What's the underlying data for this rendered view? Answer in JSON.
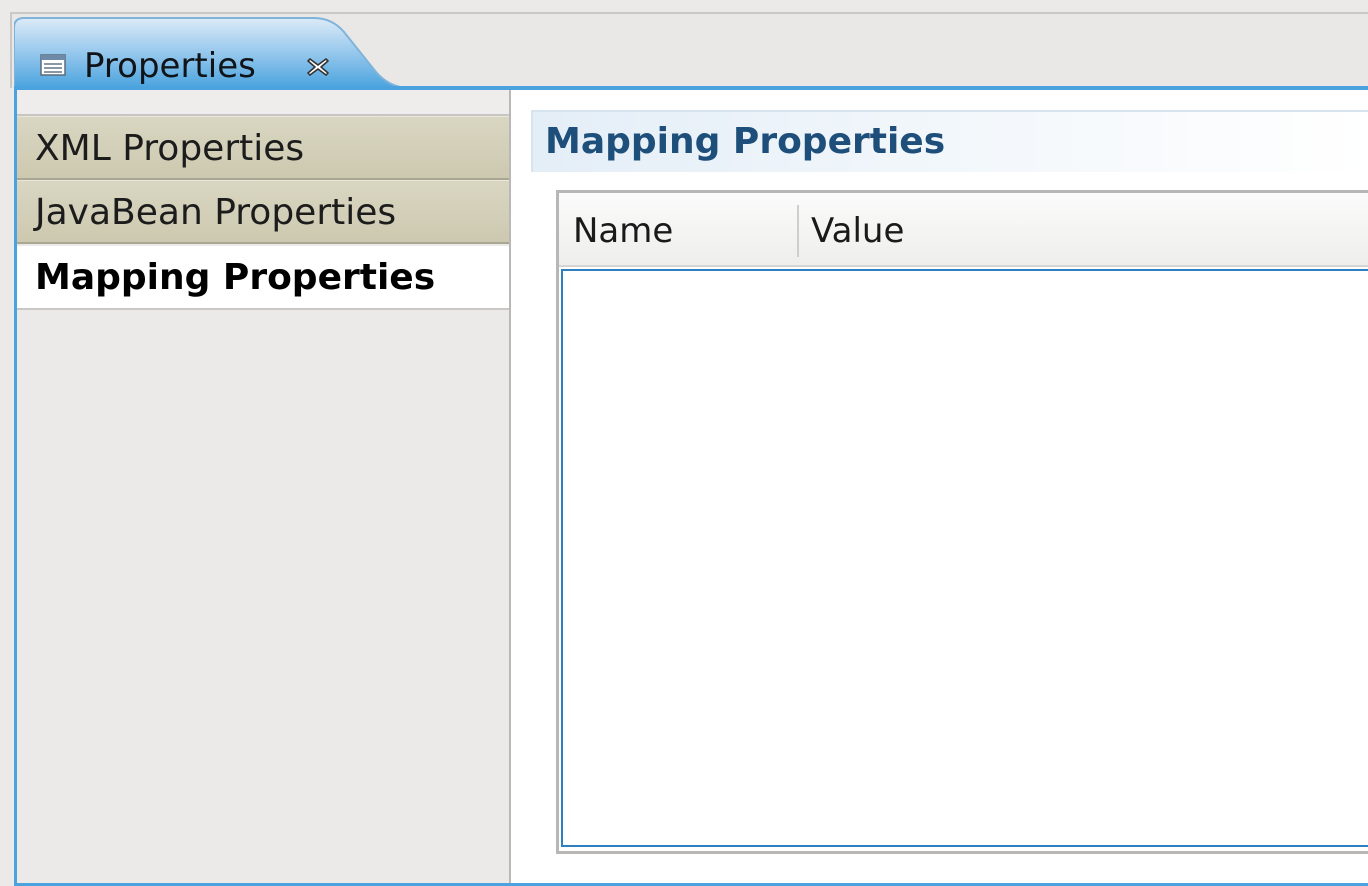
{
  "view_tab": {
    "icon": "properties-view-icon",
    "label": "Properties",
    "close_icon": "close-icon"
  },
  "sidebar": {
    "tabs": [
      {
        "label": "XML Properties",
        "selected": false
      },
      {
        "label": "JavaBean Properties",
        "selected": false
      },
      {
        "label": "Mapping Properties",
        "selected": true
      }
    ]
  },
  "section": {
    "title": "Mapping Properties"
  },
  "table": {
    "columns": [
      "Name",
      "Value"
    ],
    "rows": []
  },
  "colors": {
    "accent": "#4aa3de",
    "section_title": "#1e4e7a",
    "inactive_tab": "#d4d1bb",
    "selection_border": "#2e7fbf"
  }
}
